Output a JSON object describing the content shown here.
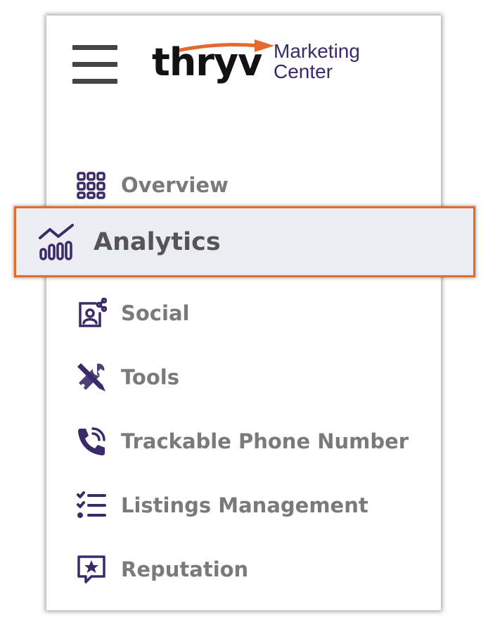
{
  "header": {
    "menu_icon": "hamburger-menu-icon",
    "logo": {
      "brand": "thryv",
      "product_line1": "Marketing",
      "product_line2": "Center",
      "arrow_color": "#e56a2e",
      "text_color": "#3a2a6a"
    }
  },
  "nav": {
    "active_index": 1,
    "accent_color": "#e56a2e",
    "icon_color": "#3a2a6a",
    "items": [
      {
        "label": "Overview",
        "icon": "grid-icon"
      },
      {
        "label": "Analytics",
        "icon": "analytics-chart-icon"
      },
      {
        "label": "Social",
        "icon": "social-share-icon"
      },
      {
        "label": "Tools",
        "icon": "tools-icon"
      },
      {
        "label": "Trackable Phone Number",
        "icon": "phone-call-icon"
      },
      {
        "label": "Listings Management",
        "icon": "checklist-icon"
      },
      {
        "label": "Reputation",
        "icon": "star-message-icon"
      }
    ]
  }
}
